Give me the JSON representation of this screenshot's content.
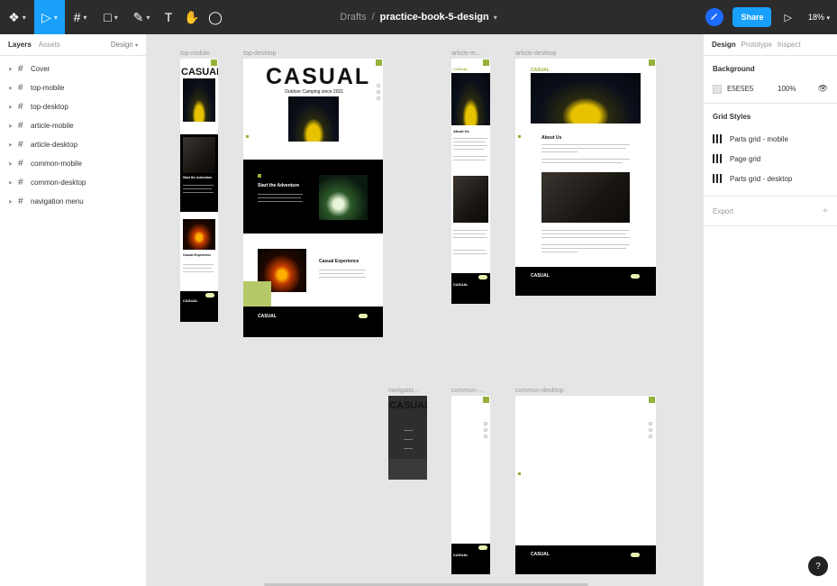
{
  "toolbar": {
    "file_path_prefix": "Drafts",
    "file_path_separator": "/",
    "file_name": "practice-book-5-design",
    "share_label": "Share",
    "zoom": "18%",
    "tools": [
      {
        "name": "figma-menu-icon",
        "glyph": "❖"
      },
      {
        "name": "move-tool-icon",
        "glyph": "▷"
      },
      {
        "name": "frame-tool-icon",
        "glyph": "#"
      },
      {
        "name": "shape-tool-icon",
        "glyph": "□"
      },
      {
        "name": "pen-tool-icon",
        "glyph": "✎"
      },
      {
        "name": "text-tool-icon",
        "glyph": "T"
      },
      {
        "name": "hand-tool-icon",
        "glyph": "✋"
      },
      {
        "name": "comment-tool-icon",
        "glyph": "◯"
      }
    ]
  },
  "left_panel": {
    "tab_layers": "Layers",
    "tab_assets": "Assets",
    "page_selector": "Design",
    "layers": [
      "Cover",
      "top-mobile",
      "top-desktop",
      "article-mobile",
      "article-desktop",
      "common-mobile",
      "common-desktop",
      "navigation menu"
    ]
  },
  "right_panel": {
    "tab_design": "Design",
    "tab_prototype": "Prototype",
    "tab_inspect": "Inspect",
    "background_title": "Background",
    "background_hex": "E5E5E5",
    "background_opacity": "100%",
    "grid_styles_title": "Grid Styles",
    "grid_styles": [
      "Parts grid - mobile",
      "Page grid",
      "Parts grid - desktop"
    ],
    "export_title": "Export"
  },
  "canvas": {
    "frame_labels": {
      "top_mobile": "top-mobile",
      "top_desktop": "top-desktop",
      "article_mobile": "article-m...",
      "article_desktop": "article-desktop",
      "navigation": "navigatio...",
      "common_mobile": "common-...",
      "common_desktop": "common-desktop"
    },
    "texts": {
      "brand_big": "CASUAL",
      "brand_small": "CASUAL",
      "tagline": "Outdoor Camping since 2021",
      "start_adventure": "Start the Adventure",
      "casual_experience": "Casual Experience",
      "about_us": "About Us"
    }
  },
  "help_label": "?",
  "colors": {
    "toolbar_bg": "#2c2c2c",
    "accent_blue": "#18a0fb",
    "lime": "#95b13a",
    "canvas_bg": "#e5e5e5"
  }
}
